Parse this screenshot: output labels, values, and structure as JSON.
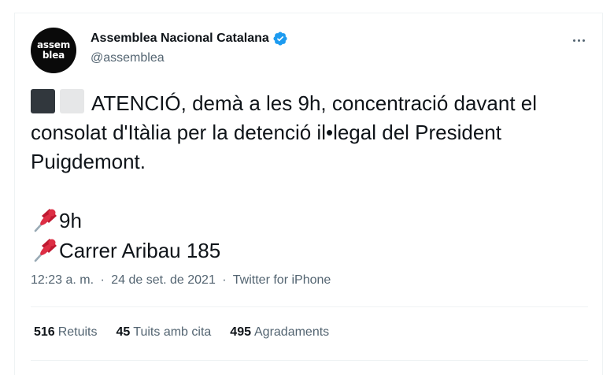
{
  "account": {
    "avatar_line1": "assem",
    "avatar_line2": "blea",
    "display_name": "Assemblea Nacional Catalana",
    "handle": "@assemblea",
    "verified_color": "#1d9bf0"
  },
  "tweet": {
    "line1": "ATENCIÓ, demà a les 9h, concentració davant el",
    "line2": "consolat d'Itàlia per la detenció il•legal del President",
    "line3": "Puigdemont.",
    "pin1_text": "9h",
    "pin2_text": "Carrer Aribau 185",
    "emoji_icons": [
      "black-square-icon",
      "white-square-icon",
      "pushpin-icon"
    ]
  },
  "meta": {
    "time": "12:23 a. m.",
    "date": "24 de set. de 2021",
    "source": "Twitter for iPhone",
    "separator": "·"
  },
  "stats": [
    {
      "count": "516",
      "label": "Retuits"
    },
    {
      "count": "45",
      "label": "Tuits amb cita"
    },
    {
      "count": "495",
      "label": "Agradaments"
    }
  ]
}
